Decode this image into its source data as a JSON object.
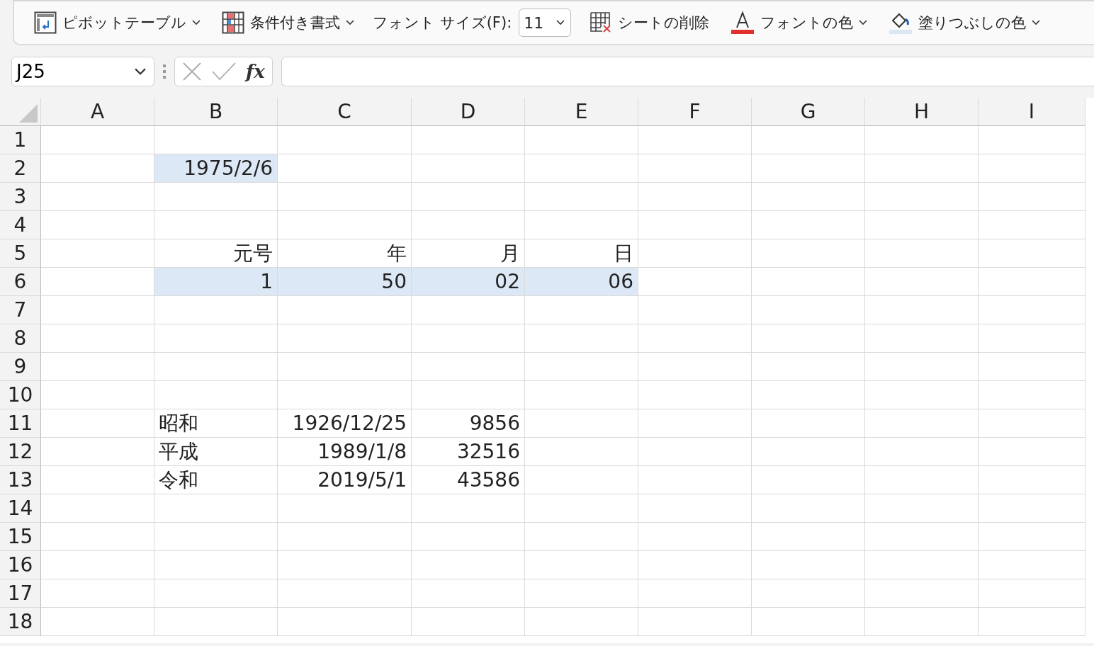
{
  "ribbon": {
    "items": [
      {
        "kind": "dropdown",
        "label": "ピボットテーブル"
      },
      {
        "kind": "dropdown",
        "label": "条件付き書式"
      },
      {
        "kind": "fontsize",
        "label": "フォント サイズ(F):",
        "value": "11"
      },
      {
        "kind": "button",
        "label": "シートの削除"
      },
      {
        "kind": "dropdown",
        "label": "フォントの色"
      },
      {
        "kind": "dropdown",
        "label": "塗りつぶしの色"
      }
    ]
  },
  "formula_bar": {
    "name_box": "J25",
    "function_symbol": "fx"
  },
  "sheet": {
    "columns": [
      "A",
      "B",
      "C",
      "D",
      "E",
      "F",
      "G",
      "H",
      "I"
    ],
    "rows": [
      {
        "number": "1",
        "cells": [
          {
            "kind": "value",
            "text": "",
            "selected": false
          },
          {
            "kind": "value",
            "text": "",
            "selected": false
          },
          {
            "kind": "value",
            "text": "",
            "selected": false
          },
          {
            "kind": "value",
            "text": "",
            "selected": false
          },
          {
            "kind": "value",
            "text": "",
            "selected": false
          },
          {
            "kind": "value",
            "text": "",
            "selected": false
          },
          {
            "kind": "value",
            "text": "",
            "selected": false
          },
          {
            "kind": "value",
            "text": "",
            "selected": false
          },
          {
            "kind": "value",
            "text": "",
            "selected": false
          }
        ]
      },
      {
        "number": "2",
        "cells": [
          {
            "kind": "value",
            "text": "",
            "selected": false
          },
          {
            "kind": "value",
            "text": "1975/2/6",
            "selected": true
          },
          {
            "kind": "value",
            "text": "",
            "selected": false
          },
          {
            "kind": "value",
            "text": "",
            "selected": false
          },
          {
            "kind": "value",
            "text": "",
            "selected": false
          },
          {
            "kind": "value",
            "text": "",
            "selected": false
          },
          {
            "kind": "value",
            "text": "",
            "selected": false
          },
          {
            "kind": "value",
            "text": "",
            "selected": false
          },
          {
            "kind": "value",
            "text": "",
            "selected": false
          }
        ]
      },
      {
        "number": "3",
        "cells": [
          {
            "kind": "value",
            "text": "",
            "selected": false
          },
          {
            "kind": "value",
            "text": "",
            "selected": false
          },
          {
            "kind": "value",
            "text": "",
            "selected": false
          },
          {
            "kind": "value",
            "text": "",
            "selected": false
          },
          {
            "kind": "value",
            "text": "",
            "selected": false
          },
          {
            "kind": "value",
            "text": "",
            "selected": false
          },
          {
            "kind": "value",
            "text": "",
            "selected": false
          },
          {
            "kind": "value",
            "text": "",
            "selected": false
          },
          {
            "kind": "value",
            "text": "",
            "selected": false
          }
        ]
      },
      {
        "number": "4",
        "cells": [
          {
            "kind": "value",
            "text": "",
            "selected": false
          },
          {
            "kind": "value",
            "text": "",
            "selected": false
          },
          {
            "kind": "value",
            "text": "",
            "selected": false
          },
          {
            "kind": "value",
            "text": "",
            "selected": false
          },
          {
            "kind": "value",
            "text": "",
            "selected": false
          },
          {
            "kind": "value",
            "text": "",
            "selected": false
          },
          {
            "kind": "value",
            "text": "",
            "selected": false
          },
          {
            "kind": "value",
            "text": "",
            "selected": false
          },
          {
            "kind": "value",
            "text": "",
            "selected": false
          }
        ]
      },
      {
        "number": "5",
        "cells": [
          {
            "kind": "value",
            "text": "",
            "selected": false
          },
          {
            "kind": "value",
            "text": "元号",
            "selected": false
          },
          {
            "kind": "value",
            "text": "年",
            "selected": false
          },
          {
            "kind": "value",
            "text": "月",
            "selected": false
          },
          {
            "kind": "value",
            "text": "日",
            "selected": false
          },
          {
            "kind": "value",
            "text": "",
            "selected": false
          },
          {
            "kind": "value",
            "text": "",
            "selected": false
          },
          {
            "kind": "value",
            "text": "",
            "selected": false
          },
          {
            "kind": "value",
            "text": "",
            "selected": false
          }
        ]
      },
      {
        "number": "6",
        "cells": [
          {
            "kind": "value",
            "text": "",
            "selected": false
          },
          {
            "kind": "value",
            "text": "1",
            "selected": true
          },
          {
            "kind": "value",
            "text": "50",
            "selected": true
          },
          {
            "kind": "value",
            "text": "02",
            "selected": true
          },
          {
            "kind": "value",
            "text": "06",
            "selected": true
          },
          {
            "kind": "value",
            "text": "",
            "selected": false
          },
          {
            "kind": "value",
            "text": "",
            "selected": false
          },
          {
            "kind": "value",
            "text": "",
            "selected": false
          },
          {
            "kind": "value",
            "text": "",
            "selected": false
          }
        ]
      },
      {
        "number": "7",
        "cells": [
          {
            "kind": "value",
            "text": "",
            "selected": false
          },
          {
            "kind": "value",
            "text": "",
            "selected": false
          },
          {
            "kind": "value",
            "text": "",
            "selected": false
          },
          {
            "kind": "value",
            "text": "",
            "selected": false
          },
          {
            "kind": "value",
            "text": "",
            "selected": false
          },
          {
            "kind": "value",
            "text": "",
            "selected": false
          },
          {
            "kind": "value",
            "text": "",
            "selected": false
          },
          {
            "kind": "value",
            "text": "",
            "selected": false
          },
          {
            "kind": "value",
            "text": "",
            "selected": false
          }
        ]
      },
      {
        "number": "8",
        "cells": [
          {
            "kind": "value",
            "text": "",
            "selected": false
          },
          {
            "kind": "value",
            "text": "",
            "selected": false
          },
          {
            "kind": "value",
            "text": "",
            "selected": false
          },
          {
            "kind": "value",
            "text": "",
            "selected": false
          },
          {
            "kind": "value",
            "text": "",
            "selected": false
          },
          {
            "kind": "value",
            "text": "",
            "selected": false
          },
          {
            "kind": "value",
            "text": "",
            "selected": false
          },
          {
            "kind": "value",
            "text": "",
            "selected": false
          },
          {
            "kind": "value",
            "text": "",
            "selected": false
          }
        ]
      },
      {
        "number": "9",
        "cells": [
          {
            "kind": "value",
            "text": "",
            "selected": false
          },
          {
            "kind": "value",
            "text": "",
            "selected": false
          },
          {
            "kind": "value",
            "text": "",
            "selected": false
          },
          {
            "kind": "value",
            "text": "",
            "selected": false
          },
          {
            "kind": "value",
            "text": "",
            "selected": false
          },
          {
            "kind": "value",
            "text": "",
            "selected": false
          },
          {
            "kind": "value",
            "text": "",
            "selected": false
          },
          {
            "kind": "value",
            "text": "",
            "selected": false
          },
          {
            "kind": "value",
            "text": "",
            "selected": false
          }
        ]
      },
      {
        "number": "10",
        "cells": [
          {
            "kind": "value",
            "text": "",
            "selected": false
          },
          {
            "kind": "value",
            "text": "",
            "selected": false
          },
          {
            "kind": "value",
            "text": "",
            "selected": false
          },
          {
            "kind": "value",
            "text": "",
            "selected": false
          },
          {
            "kind": "value",
            "text": "",
            "selected": false
          },
          {
            "kind": "value",
            "text": "",
            "selected": false
          },
          {
            "kind": "value",
            "text": "",
            "selected": false
          },
          {
            "kind": "value",
            "text": "",
            "selected": false
          },
          {
            "kind": "value",
            "text": "",
            "selected": false
          }
        ]
      },
      {
        "number": "11",
        "cells": [
          {
            "kind": "value",
            "text": "",
            "selected": false
          },
          {
            "kind": "label",
            "text": "昭和",
            "selected": false
          },
          {
            "kind": "value",
            "text": "1926/12/25",
            "selected": false
          },
          {
            "kind": "value",
            "text": "9856",
            "selected": false
          },
          {
            "kind": "value",
            "text": "",
            "selected": false
          },
          {
            "kind": "value",
            "text": "",
            "selected": false
          },
          {
            "kind": "value",
            "text": "",
            "selected": false
          },
          {
            "kind": "value",
            "text": "",
            "selected": false
          },
          {
            "kind": "value",
            "text": "",
            "selected": false
          }
        ]
      },
      {
        "number": "12",
        "cells": [
          {
            "kind": "value",
            "text": "",
            "selected": false
          },
          {
            "kind": "label",
            "text": "平成",
            "selected": false
          },
          {
            "kind": "value",
            "text": "1989/1/8",
            "selected": false
          },
          {
            "kind": "value",
            "text": "32516",
            "selected": false
          },
          {
            "kind": "value",
            "text": "",
            "selected": false
          },
          {
            "kind": "value",
            "text": "",
            "selected": false
          },
          {
            "kind": "value",
            "text": "",
            "selected": false
          },
          {
            "kind": "value",
            "text": "",
            "selected": false
          },
          {
            "kind": "value",
            "text": "",
            "selected": false
          }
        ]
      },
      {
        "number": "13",
        "cells": [
          {
            "kind": "value",
            "text": "",
            "selected": false
          },
          {
            "kind": "label",
            "text": "令和",
            "selected": false
          },
          {
            "kind": "value",
            "text": "2019/5/1",
            "selected": false
          },
          {
            "kind": "value",
            "text": "43586",
            "selected": false
          },
          {
            "kind": "value",
            "text": "",
            "selected": false
          },
          {
            "kind": "value",
            "text": "",
            "selected": false
          },
          {
            "kind": "value",
            "text": "",
            "selected": false
          },
          {
            "kind": "value",
            "text": "",
            "selected": false
          },
          {
            "kind": "value",
            "text": "",
            "selected": false
          }
        ]
      },
      {
        "number": "14",
        "cells": [
          {
            "kind": "value",
            "text": "",
            "selected": false
          },
          {
            "kind": "value",
            "text": "",
            "selected": false
          },
          {
            "kind": "value",
            "text": "",
            "selected": false
          },
          {
            "kind": "value",
            "text": "",
            "selected": false
          },
          {
            "kind": "value",
            "text": "",
            "selected": false
          },
          {
            "kind": "value",
            "text": "",
            "selected": false
          },
          {
            "kind": "value",
            "text": "",
            "selected": false
          },
          {
            "kind": "value",
            "text": "",
            "selected": false
          },
          {
            "kind": "value",
            "text": "",
            "selected": false
          }
        ]
      },
      {
        "number": "15",
        "cells": [
          {
            "kind": "value",
            "text": "",
            "selected": false
          },
          {
            "kind": "value",
            "text": "",
            "selected": false
          },
          {
            "kind": "value",
            "text": "",
            "selected": false
          },
          {
            "kind": "value",
            "text": "",
            "selected": false
          },
          {
            "kind": "value",
            "text": "",
            "selected": false
          },
          {
            "kind": "value",
            "text": "",
            "selected": false
          },
          {
            "kind": "value",
            "text": "",
            "selected": false
          },
          {
            "kind": "value",
            "text": "",
            "selected": false
          },
          {
            "kind": "value",
            "text": "",
            "selected": false
          }
        ]
      },
      {
        "number": "16",
        "cells": [
          {
            "kind": "value",
            "text": "",
            "selected": false
          },
          {
            "kind": "value",
            "text": "",
            "selected": false
          },
          {
            "kind": "value",
            "text": "",
            "selected": false
          },
          {
            "kind": "value",
            "text": "",
            "selected": false
          },
          {
            "kind": "value",
            "text": "",
            "selected": false
          },
          {
            "kind": "value",
            "text": "",
            "selected": false
          },
          {
            "kind": "value",
            "text": "",
            "selected": false
          },
          {
            "kind": "value",
            "text": "",
            "selected": false
          },
          {
            "kind": "value",
            "text": "",
            "selected": false
          }
        ]
      },
      {
        "number": "17",
        "cells": [
          {
            "kind": "value",
            "text": "",
            "selected": false
          },
          {
            "kind": "value",
            "text": "",
            "selected": false
          },
          {
            "kind": "value",
            "text": "",
            "selected": false
          },
          {
            "kind": "value",
            "text": "",
            "selected": false
          },
          {
            "kind": "value",
            "text": "",
            "selected": false
          },
          {
            "kind": "value",
            "text": "",
            "selected": false
          },
          {
            "kind": "value",
            "text": "",
            "selected": false
          },
          {
            "kind": "value",
            "text": "",
            "selected": false
          },
          {
            "kind": "value",
            "text": "",
            "selected": false
          }
        ]
      },
      {
        "number": "18",
        "cells": [
          {
            "kind": "value",
            "text": "",
            "selected": false
          },
          {
            "kind": "value",
            "text": "",
            "selected": false
          },
          {
            "kind": "value",
            "text": "",
            "selected": false
          },
          {
            "kind": "value",
            "text": "",
            "selected": false
          },
          {
            "kind": "value",
            "text": "",
            "selected": false
          },
          {
            "kind": "value",
            "text": "",
            "selected": false
          },
          {
            "kind": "value",
            "text": "",
            "selected": false
          },
          {
            "kind": "value",
            "text": "",
            "selected": false
          },
          {
            "kind": "value",
            "text": "",
            "selected": false
          }
        ]
      }
    ]
  }
}
